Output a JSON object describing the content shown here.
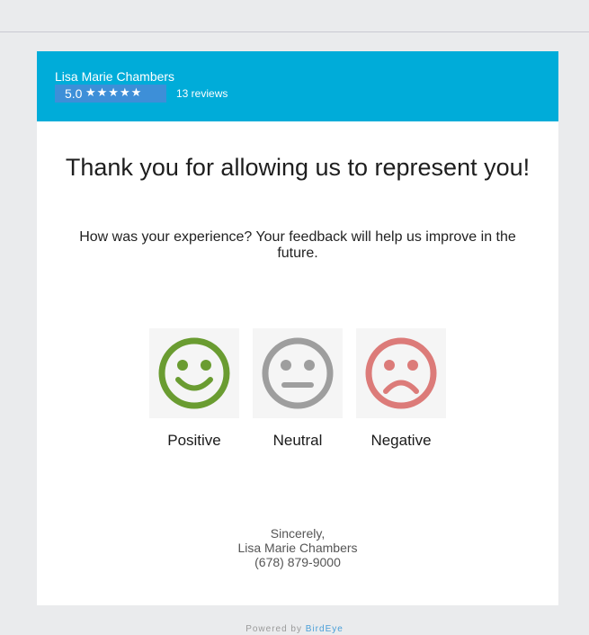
{
  "business": {
    "name": "Lisa Marie Chambers",
    "rating": "5.0",
    "stars": "★★★★★",
    "reviews": "13 reviews"
  },
  "main": {
    "headline": "Thank you for allowing us to represent you!",
    "prompt": "How was your experience? Your feedback will help us improve in the future."
  },
  "feedback": {
    "positive": {
      "label": "Positive",
      "icon": "smiley-happy-icon",
      "color": "#6a9c31"
    },
    "neutral": {
      "label": "Neutral",
      "icon": "smiley-neutral-icon",
      "color": "#9e9e9e"
    },
    "negative": {
      "label": "Negative",
      "icon": "smiley-sad-icon",
      "color": "#dc7b79"
    }
  },
  "signoff": {
    "closing": "Sincerely,",
    "name": "Lisa Marie Chambers",
    "phone": "(678) 879-9000"
  },
  "footer": {
    "powered_by": "Powered by",
    "brand": "BirdEye"
  },
  "colors": {
    "header_bg": "#00acd9",
    "rating_badge_bg": "#3d8fd8",
    "page_bg": "#eaebed"
  }
}
